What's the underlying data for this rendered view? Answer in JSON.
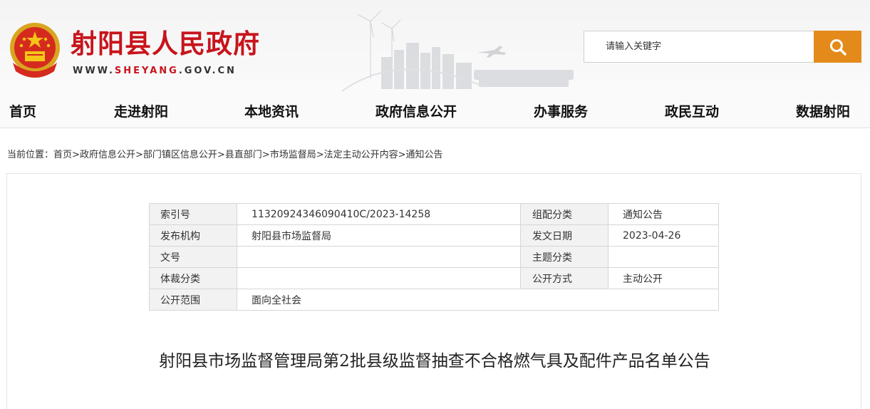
{
  "header": {
    "title": "射阳县人民政府",
    "url_prefix": "WWW.",
    "url_brand": "SHEYANG",
    "url_suffix": ".GOV.CN",
    "emblem_icon": "national-emblem-icon",
    "brand_color": "#c8141c"
  },
  "search": {
    "placeholder": "请输入关键字",
    "button_icon": "search-icon",
    "button_color": "#e48a1b"
  },
  "nav": {
    "items": [
      "首页",
      "走进射阳",
      "本地资讯",
      "政府信息公开",
      "办事服务",
      "政民互动",
      "数据射阳"
    ]
  },
  "breadcrumb": {
    "prefix": "当前位置：",
    "separator": ">",
    "items": [
      "首页",
      "政府信息公开",
      "部门镇区信息公开",
      "县直部门",
      "市场监督局",
      "法定主动公开内容",
      "通知公告"
    ]
  },
  "info_table": {
    "index_label": "索引号",
    "index_value": "11320924346090410C/2023-14258",
    "category_label": "组配分类",
    "category_value": "通知公告",
    "publisher_label": "发布机构",
    "publisher_value": "射阳县市场监督局",
    "date_label": "发文日期",
    "date_value": "2023-04-26",
    "docno_label": "文号",
    "docno_value": "",
    "topic_label": "主题分类",
    "topic_value": "",
    "genre_label": "体裁分类",
    "genre_value": "",
    "method_label": "公开方式",
    "method_value": "主动公开",
    "scope_label": "公开范围",
    "scope_value": "面向全社会"
  },
  "article": {
    "title": "射阳县市场监督管理局第2批县级监督抽查不合格燃气具及配件产品名单公告"
  }
}
